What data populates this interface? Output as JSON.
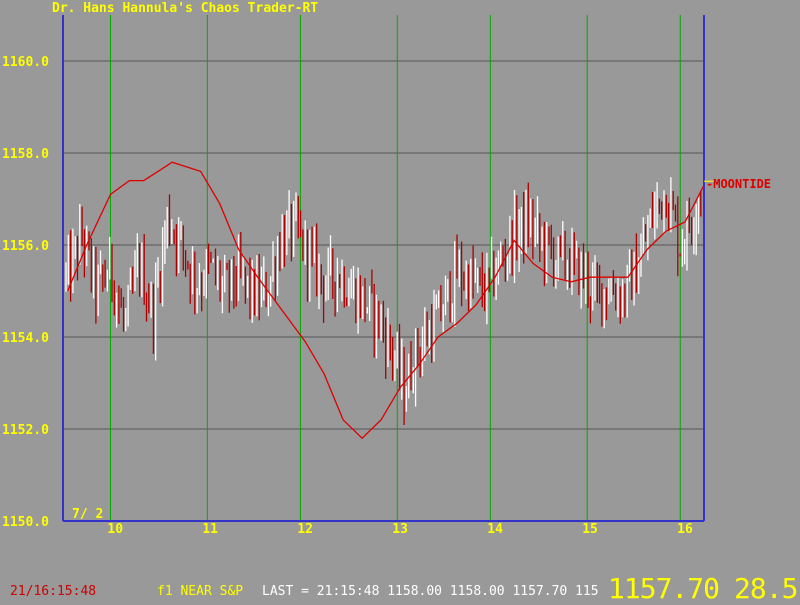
{
  "title": "Dr. Hans Hannula's Chaos Trader-RT",
  "chart_data": {
    "type": "line",
    "x_range": [
      9.45,
      16.2
    ],
    "y_range": [
      1150.0,
      1161.0
    ],
    "y_ticks": [
      1150.0,
      1152.0,
      1154.0,
      1156.0,
      1158.0,
      1160.0
    ],
    "y_tick_labels": [
      "1150.0",
      "1152.0",
      "1154.0",
      "1156.0",
      "1158.0",
      "1160.0"
    ],
    "x_ticks": [
      10,
      11,
      12,
      13,
      14,
      15,
      16
    ],
    "x_tick_labels": [
      "10",
      "11",
      "12",
      "13",
      "14",
      "15",
      "16"
    ],
    "vertical_gridlines": [
      9.95,
      10.97,
      11.95,
      12.97,
      13.95,
      14.97,
      15.95
    ],
    "date_label": "7/ 2",
    "grid": true,
    "colors": {
      "axes": "#3333cc",
      "hgrid": "#555555",
      "vgrid": "#00aa00",
      "labels": "#ffff00",
      "up_bar": "#ffffff",
      "down_bar": "#aa0000",
      "indicator": "#dd0000"
    },
    "indicator": {
      "name": "MOONTIDE",
      "x": [
        9.5,
        9.7,
        9.95,
        10.15,
        10.3,
        10.45,
        10.6,
        10.9,
        11.1,
        11.3,
        11.5,
        11.75,
        12.0,
        12.2,
        12.4,
        12.6,
        12.8,
        13.0,
        13.2,
        13.4,
        13.6,
        13.8,
        14.0,
        14.2,
        14.4,
        14.6,
        14.8,
        15.0,
        15.2,
        15.4,
        15.6,
        15.8,
        16.0,
        16.2
      ],
      "y": [
        1155.0,
        1156.0,
        1157.1,
        1157.4,
        1157.4,
        1157.6,
        1157.8,
        1157.6,
        1156.9,
        1155.9,
        1155.3,
        1154.6,
        1153.9,
        1153.2,
        1152.2,
        1151.8,
        1152.2,
        1152.9,
        1153.4,
        1154.0,
        1154.3,
        1154.7,
        1155.3,
        1156.1,
        1155.6,
        1155.3,
        1155.2,
        1155.3,
        1155.3,
        1155.3,
        1155.9,
        1156.3,
        1156.5,
        1157.3
      ]
    },
    "price_anchors": {
      "x": [
        9.5,
        9.65,
        9.8,
        9.95,
        10.1,
        10.25,
        10.4,
        10.55,
        10.7,
        10.85,
        11.0,
        11.15,
        11.3,
        11.45,
        11.6,
        11.75,
        11.9,
        12.05,
        12.2,
        12.35,
        12.5,
        12.65,
        12.8,
        12.95,
        13.05,
        13.15,
        13.3,
        13.45,
        13.6,
        13.75,
        13.9,
        14.05,
        14.2,
        14.35,
        14.5,
        14.65,
        14.8,
        14.95,
        15.05,
        15.2,
        15.35,
        15.5,
        15.65,
        15.8,
        15.95,
        16.1,
        16.2
      ],
      "y": [
        1155.3,
        1156.2,
        1155.0,
        1155.5,
        1154.2,
        1155.6,
        1154.5,
        1156.6,
        1156.0,
        1155.2,
        1155.5,
        1155.0,
        1155.3,
        1154.9,
        1155.0,
        1156.2,
        1156.3,
        1155.7,
        1155.2,
        1155.4,
        1155.0,
        1154.7,
        1154.3,
        1153.5,
        1152.8,
        1153.6,
        1154.1,
        1154.6,
        1155.4,
        1155.2,
        1155.0,
        1155.6,
        1156.2,
        1156.5,
        1156.0,
        1155.7,
        1155.6,
        1155.3,
        1154.9,
        1155.1,
        1154.9,
        1155.5,
        1156.6,
        1157.2,
        1156.0,
        1156.8,
        1157.3
      ]
    }
  },
  "status_bar": {
    "timestamp": "21/16:15:48",
    "symbol": "f1 NEAR S&P",
    "last": "LAST = 21:15:48 1158.00 1158.00 1157.70 115",
    "big_price": "1157.70",
    "big_change": "28.5"
  }
}
